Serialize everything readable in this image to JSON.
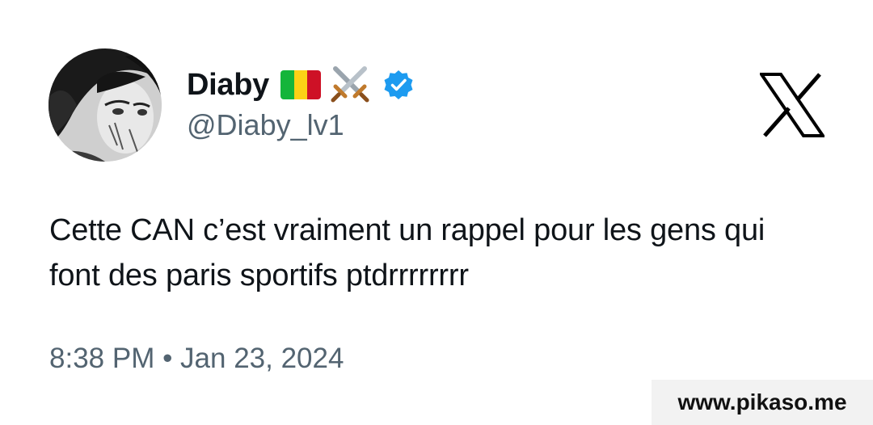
{
  "author": {
    "display_name": "Diaby",
    "handle": "@Diaby_lv1",
    "flag_colors": [
      "#14b53a",
      "#fcd116",
      "#ce1126"
    ],
    "emojis": [
      "mali-flag-icon",
      "crossed-swords-icon"
    ],
    "verified": true,
    "verified_color": "#1d9bf0"
  },
  "tweet": {
    "text": "Cette CAN c’est vraiment un rappel pour les gens qui font des paris sportifs ptdrrrrrrrr",
    "timestamp": "8:38 PM • Jan 23, 2024"
  },
  "platform_icon": "x-logo-icon",
  "watermark": {
    "text": "www.pikaso.me"
  }
}
